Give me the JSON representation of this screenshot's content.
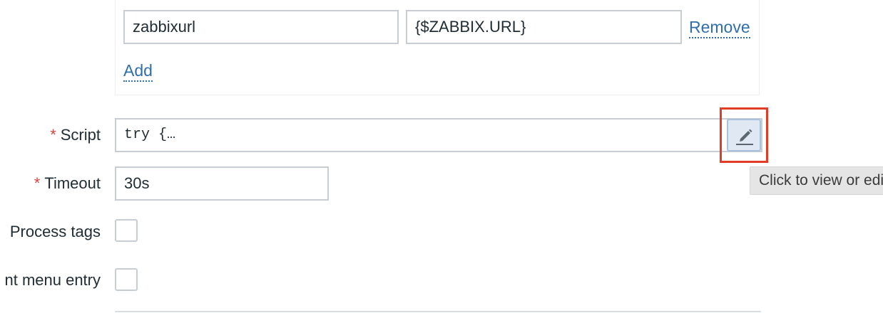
{
  "params": {
    "rows": [
      {
        "name": "zabbixurl",
        "value": "{$ZABBIX.URL}",
        "remove_label": "Remove"
      }
    ],
    "add_label": "Add"
  },
  "script": {
    "required_marker": "*",
    "label": "Script",
    "value": "try {…",
    "edit_icon": "pencil-icon"
  },
  "tooltip": {
    "text": "Click to view or edit"
  },
  "timeout": {
    "required_marker": "*",
    "label": "Timeout",
    "value": "30s"
  },
  "process_tags": {
    "label": "Process tags",
    "checked": false
  },
  "menu_entry": {
    "label": "nt menu entry",
    "checked": false
  },
  "colors": {
    "accent_link": "#2f6eac",
    "required": "#d64541",
    "highlight": "#e23b26"
  }
}
